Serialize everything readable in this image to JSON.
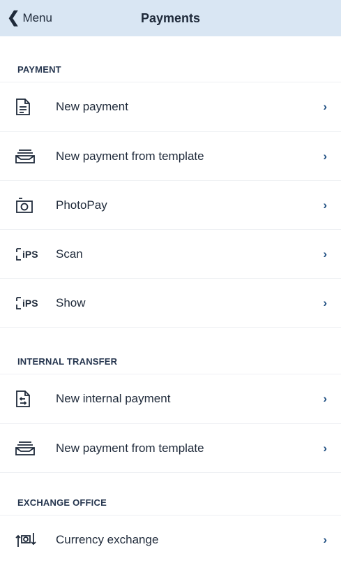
{
  "header": {
    "back_label": "Menu",
    "title": "Payments"
  },
  "sections": [
    {
      "title": "PAYMENT",
      "items": [
        {
          "label": "New payment",
          "icon": "document-icon"
        },
        {
          "label": "New payment from template",
          "icon": "template-tray-icon"
        },
        {
          "label": "PhotoPay",
          "icon": "camera-icon"
        },
        {
          "label": "Scan",
          "icon": "ips-qr-icon"
        },
        {
          "label": "Show",
          "icon": "ips-qr-icon"
        }
      ]
    },
    {
      "title": "INTERNAL TRANSFER",
      "items": [
        {
          "label": "New internal payment",
          "icon": "internal-transfer-icon"
        },
        {
          "label": "New payment from template",
          "icon": "template-tray-icon"
        }
      ]
    },
    {
      "title": "EXCHANGE OFFICE",
      "items": [
        {
          "label": "Currency exchange",
          "icon": "currency-exchange-icon"
        }
      ]
    }
  ],
  "ips_text": "iPS",
  "colors": {
    "header_bg": "#d9e6f3",
    "chevron": "#1f4f82",
    "text": "#1f2a3a"
  }
}
